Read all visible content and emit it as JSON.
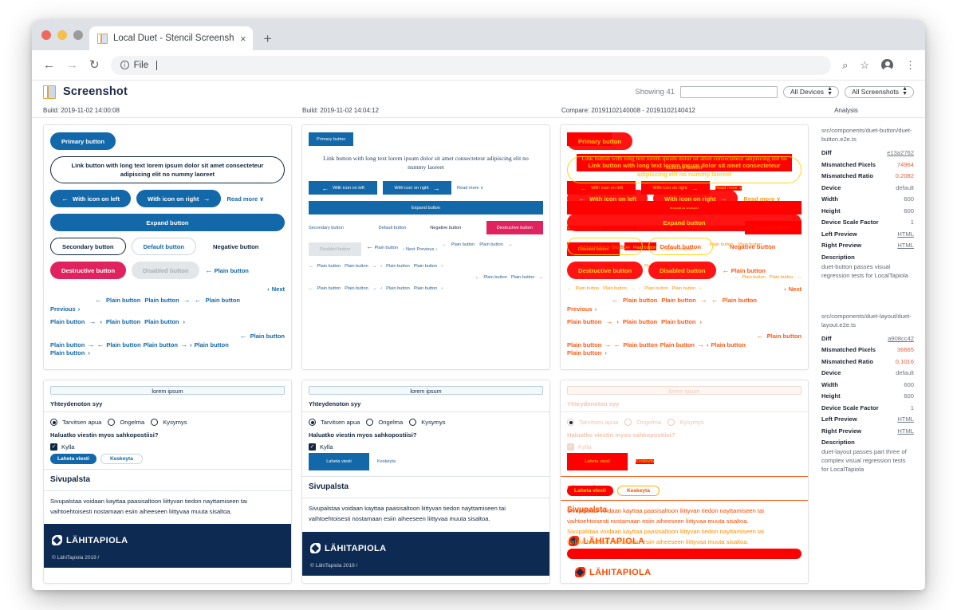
{
  "browser": {
    "tab_title": "Local Duet - Stencil Screenshot",
    "tab_close": "×",
    "new_tab": "+",
    "back": "←",
    "forward": "→",
    "reload": "↻",
    "omnibox_info": "ⓘ",
    "omnibox_value": "File",
    "search_icon": "⌕",
    "star_icon": "☆",
    "menu_icon": "⋮"
  },
  "app": {
    "title": "Screenshot",
    "showing_label": "Showing 41",
    "filter_value": "",
    "filter_placeholder": "",
    "device_filter": "All Devices",
    "screenshot_filter": "All Screenshots",
    "stepper_glyph": "⬍"
  },
  "columns": {
    "left": "Build: 2019-11-02 14:00:08",
    "right": "Build: 2019-11-02 14:04:12",
    "compare": "Compare: 20191102140008 - 20191102140412",
    "analysis": "Analysis"
  },
  "duet_button": {
    "primary": "Primary button",
    "link_long": "Link button with long text lorem ipsum dolor sit amet consecteteur adipiscing elit no nummy laoreet",
    "icon_left": "With icon on left",
    "icon_right": "With icon on right",
    "read_more": "Read more",
    "expand": "Expand button",
    "secondary": "Secondary button",
    "default": "Default button",
    "negative": "Negative button",
    "destructive": "Destructive button",
    "disabled": "Disabled button",
    "plain": "Plain button",
    "next": "Next",
    "previous": "Previous",
    "arrow_left": "←",
    "arrow_right": "→",
    "chev_left": "‹",
    "chev_right": "›",
    "chev_down": "∨"
  },
  "duet_layout": {
    "lorem": "lorem ipsum",
    "reason_label": "Yhteydenoton syy",
    "radio_1": "Tarvitsen apua",
    "radio_2": "Ongelma",
    "radio_3": "Kysymys",
    "email_label": "Haluatko viestin myos sahkopostiisi?",
    "checkbox_label": "Kylla",
    "checkbox_glyph": "✓",
    "send": "Laheta viesti",
    "cancel": "Keskeyta",
    "sidebar_heading": "Sivupalsta",
    "sidebar_text": "Sivupalstaa voidaan kayttaa paasisaltoon liittyvan tiedon nayttamiseen tai vaihtoehtoisesti nostamaan esiin aiheeseen liittyvaa muuta sisaltoa.",
    "brand": "LÄHITAPIOLA",
    "copyright": "© LähiTapiola 2019  /"
  },
  "analysis": [
    {
      "path": "src/components/duet-button/duet-button.e2e.ts",
      "rows": [
        {
          "key": "Diff",
          "value": "e13a2762",
          "style": "link"
        },
        {
          "key": "Mismatched Pixels",
          "value": "74964",
          "style": "warn"
        },
        {
          "key": "Mismatched Ratio",
          "value": "0.2082",
          "style": "warn"
        },
        {
          "key": "Device",
          "value": "default",
          "style": ""
        },
        {
          "key": "Width",
          "value": "600",
          "style": ""
        },
        {
          "key": "Height",
          "value": "600",
          "style": ""
        },
        {
          "key": "Device Scale Factor",
          "value": "1",
          "style": ""
        },
        {
          "key": "Left Preview",
          "value": "HTML",
          "style": "link"
        },
        {
          "key": "Right Preview",
          "value": "HTML",
          "style": "link"
        }
      ],
      "description_label": "Description",
      "description": "duet-button passes visual regression tests for LocalTapiola"
    },
    {
      "path": "src/components/duet-layout/duet-layout.e2e.ts",
      "rows": [
        {
          "key": "Diff",
          "value": "a908cc42",
          "style": "link"
        },
        {
          "key": "Mismatched Pixels",
          "value": "36665",
          "style": "warn"
        },
        {
          "key": "Mismatched Ratio",
          "value": "0.1016",
          "style": "warn"
        },
        {
          "key": "Device",
          "value": "default",
          "style": ""
        },
        {
          "key": "Width",
          "value": "600",
          "style": ""
        },
        {
          "key": "Height",
          "value": "600",
          "style": ""
        },
        {
          "key": "Device Scale Factor",
          "value": "1",
          "style": ""
        },
        {
          "key": "Left Preview",
          "value": "HTML",
          "style": "link"
        },
        {
          "key": "Right Preview",
          "value": "HTML",
          "style": "link"
        }
      ],
      "description_label": "Description",
      "description": "duet-layout passes part three of complex visual regression tests for LocalTapiola"
    }
  ],
  "colors": {
    "primary_blue": "#1268a8",
    "destructive_pink": "#e0225f",
    "navy": "#0d2b52",
    "diff_red": "#ff0000",
    "diff_yellow": "#ffd400",
    "warn": "#f05a3c"
  }
}
